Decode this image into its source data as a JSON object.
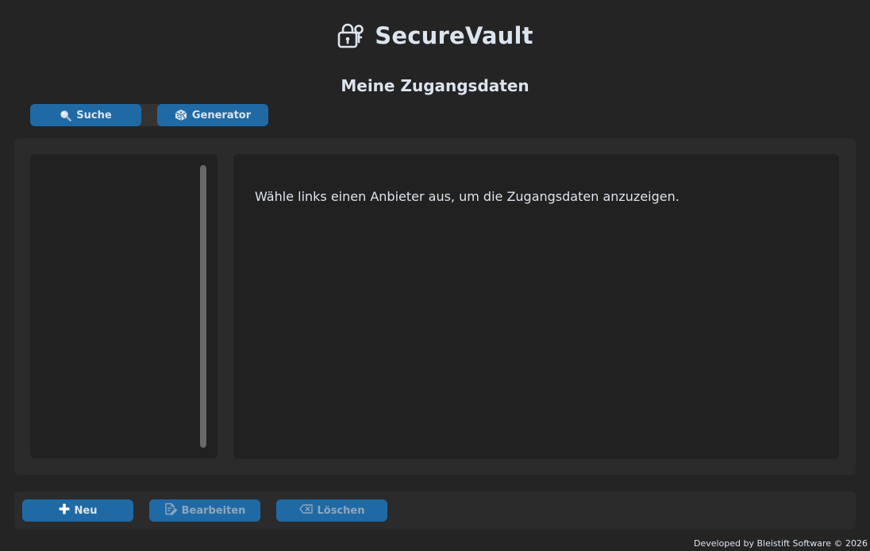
{
  "header": {
    "title": "SecureVault",
    "logo_icon": "lock-key-icon"
  },
  "subtitle": "Meine Zugangsdaten",
  "tabs": [
    {
      "label": "Suche",
      "icon": "magnifier-icon"
    },
    {
      "label": "Generator",
      "icon": "dice-icon"
    }
  ],
  "list": {
    "items": []
  },
  "detail": {
    "hint": "Wähle links einen Anbieter aus, um die Zugangsdaten anzuzeigen."
  },
  "actions": {
    "new_label": "Neu",
    "edit_label": "Bearbeiten",
    "delete_label": "Löschen"
  },
  "footer": {
    "text": "Developed by Bleistift Software © 2026"
  },
  "colors": {
    "background": "#242424",
    "panel": "#2b2b2b",
    "inner_panel": "#212121",
    "accent": "#1f6aa5",
    "text": "#dce4ee",
    "disabled_text": "#8fa6bd"
  }
}
